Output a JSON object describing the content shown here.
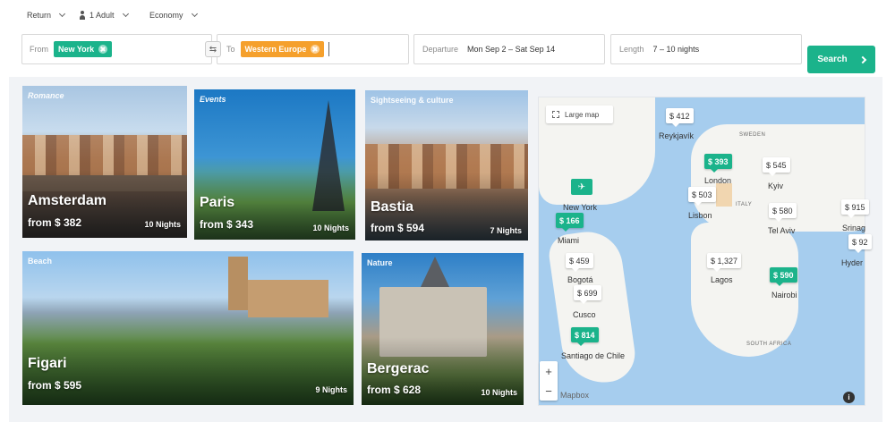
{
  "options": {
    "trip_type": "Return",
    "passengers": "1 Adult",
    "cabin": "Economy"
  },
  "search": {
    "from_label": "From",
    "from_value": "New York",
    "to_label": "To",
    "to_value": "Western Europe",
    "departure_label": "Departure",
    "departure_value": "Mon Sep 2 – Sat Sep 14",
    "length_label": "Length",
    "length_value": "7 – 10 nights",
    "search_button": "Search"
  },
  "colors": {
    "accent": "#1bb38b",
    "tag_orange": "#f5a02c",
    "map_water": "#a6cdee"
  },
  "cards": [
    {
      "category": "Romance",
      "city": "Amsterdam",
      "price": "from $ 382",
      "nights": "10 Nights"
    },
    {
      "category": "Events",
      "city": "Paris",
      "price": "from $ 343",
      "nights": "10 Nights"
    },
    {
      "category": "Sightseeing & culture",
      "city": "Bastia",
      "price": "from $ 594",
      "nights": "7 Nights"
    },
    {
      "category": "Beach",
      "city": "Figari",
      "price": "from $ 595",
      "nights": "9 Nights"
    },
    {
      "category": "Nature",
      "city": "Bergerac",
      "price": "from $ 628",
      "nights": "10 Nights"
    }
  ],
  "map": {
    "large_map_label": "Large map",
    "attribution": "Mapbox",
    "zoom_in": "+",
    "zoom_out": "−",
    "info": "i",
    "pins": [
      {
        "price": "$ 412",
        "highlight": false
      },
      {
        "price": "$ 393",
        "highlight": true
      },
      {
        "price": "$ 545",
        "highlight": false
      },
      {
        "price": "$ 503",
        "highlight": false
      },
      {
        "price": "$ 580",
        "highlight": false
      },
      {
        "price": "$ 915",
        "highlight": false
      },
      {
        "price": "$ 92",
        "highlight": false
      },
      {
        "price": "$ 166",
        "highlight": true
      },
      {
        "price": "$ 459",
        "highlight": false
      },
      {
        "price": "$ 1,327",
        "highlight": false
      },
      {
        "price": "$ 590",
        "highlight": true
      },
      {
        "price": "$ 699",
        "highlight": false
      },
      {
        "price": "$ 814",
        "highlight": true
      }
    ],
    "places": [
      "Reykjavík",
      "London",
      "Lisbon",
      "Kyiv",
      "Tel Aviv",
      "Srinag",
      "Hyder",
      "New York",
      "Miami",
      "Bogotá",
      "Lagos",
      "Nairobi",
      "Cusco",
      "Santiago de Chile"
    ],
    "regions": [
      "SWEDEN",
      "ITALY",
      "SOUTH AFRICA"
    ]
  }
}
